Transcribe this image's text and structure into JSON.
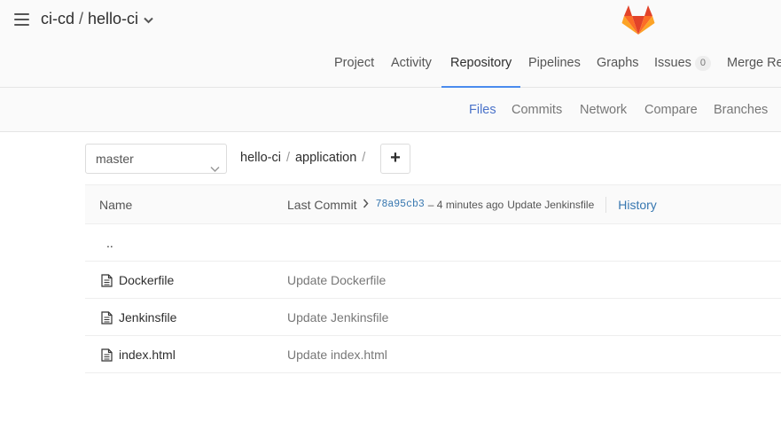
{
  "header": {
    "group": "ci-cd",
    "separator": "/",
    "project": "hello-ci",
    "icons": {
      "menu": "hamburger-icon",
      "dropdown": "chevron-down-icon",
      "logo": "gitlab-tanuki-logo"
    },
    "colors": {
      "logo_dark": "#e24329",
      "logo_mid": "#fc6d26",
      "logo_light": "#fca326"
    }
  },
  "nav": {
    "items": [
      {
        "label": "Project"
      },
      {
        "label": "Activity"
      },
      {
        "label": "Repository",
        "active": true
      },
      {
        "label": "Pipelines"
      },
      {
        "label": "Graphs"
      },
      {
        "label": "Issues",
        "badge": "0"
      },
      {
        "label": "Merge Req"
      }
    ],
    "active_color": "#4a8bee"
  },
  "subnav": {
    "items": [
      {
        "label": "Files",
        "active": true
      },
      {
        "label": "Commits"
      },
      {
        "label": "Network"
      },
      {
        "label": "Compare"
      },
      {
        "label": "Branches"
      }
    ],
    "active_color": "#4a72c9"
  },
  "toolbar": {
    "branch": "master",
    "path": {
      "root": "hello-ci",
      "sep": "/",
      "dir": "application",
      "trail": "/"
    },
    "add_icon": "plus-icon",
    "add_label": "+"
  },
  "tree": {
    "header": {
      "name": "Name",
      "last_commit": "Last Commit",
      "sha": "78a95cb3",
      "meta": "– 4 minutes ago",
      "message": "Update Jenkinsfile",
      "history": "History"
    },
    "parent": "..",
    "rows": [
      {
        "name": "Dockerfile",
        "commit": "Update Dockerfile",
        "icon": "file-icon"
      },
      {
        "name": "Jenkinsfile",
        "commit": "Update Jenkinsfile",
        "icon": "file-icon"
      },
      {
        "name": "index.html",
        "commit": "Update index.html",
        "icon": "file-icon"
      }
    ],
    "link_color": "#3777b0"
  }
}
